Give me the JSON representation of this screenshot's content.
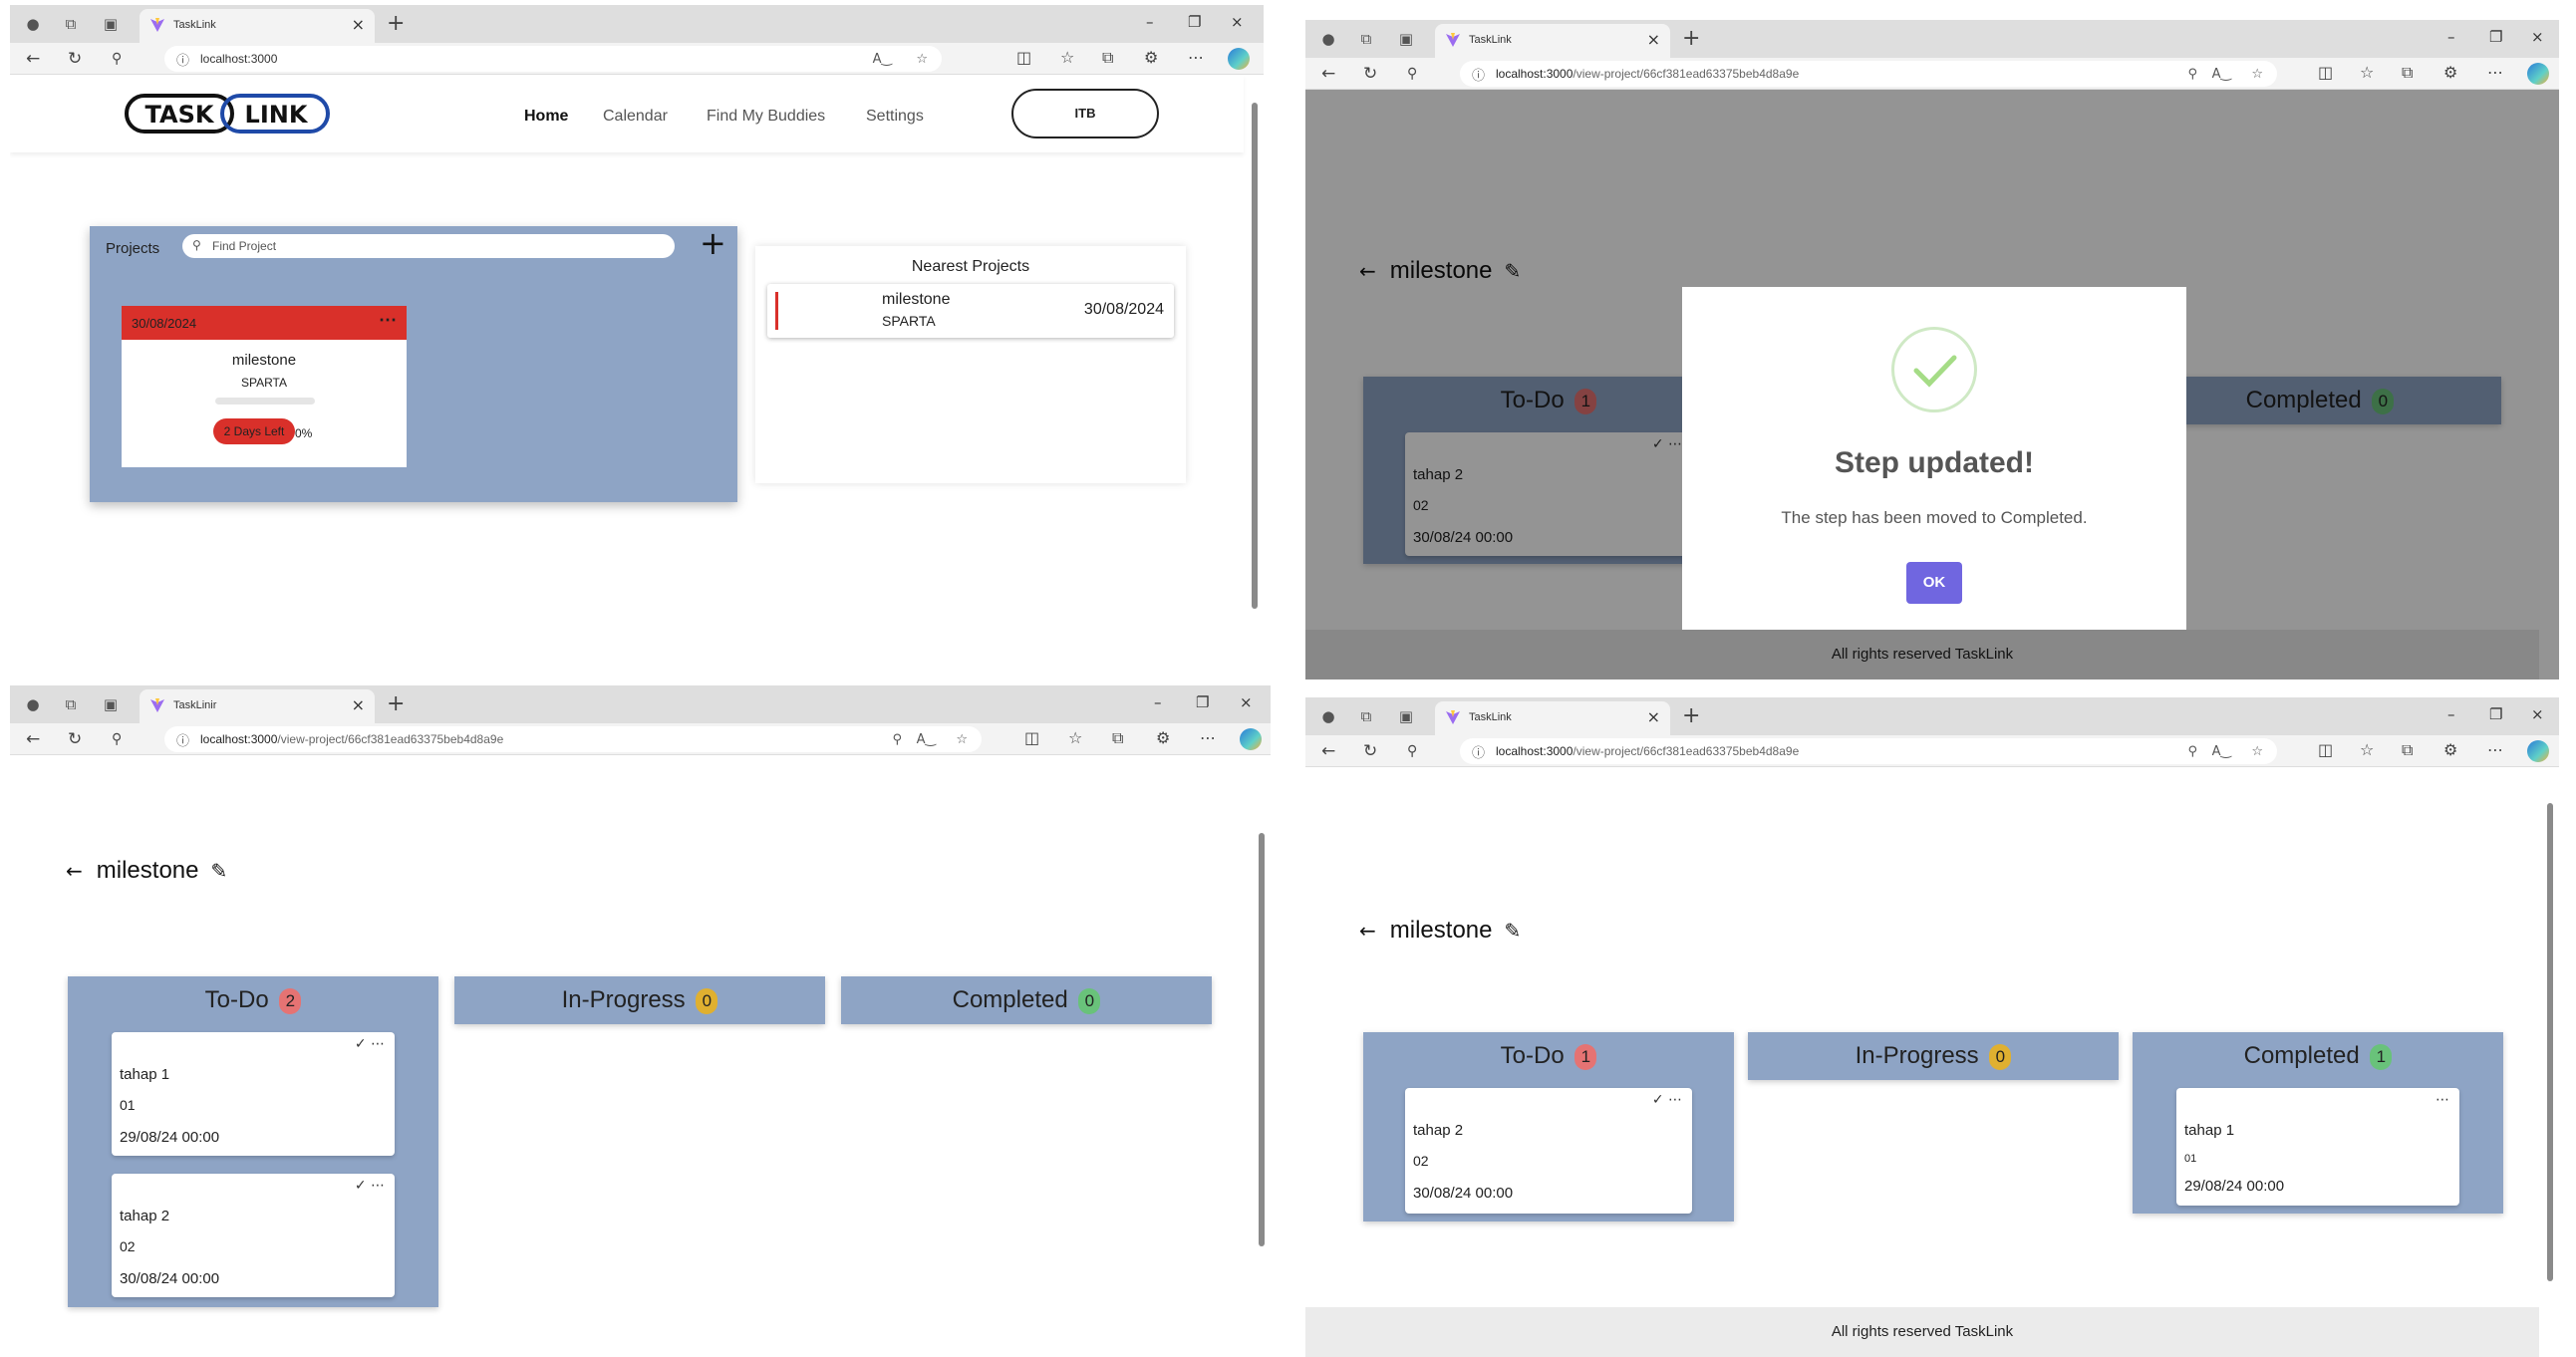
{
  "browser": {
    "tab_title": "TaskLink",
    "tab_title_c": "TaskLinir",
    "url_home": "localhost:3000",
    "url_host": "localhost:3000",
    "url_path": "/view-project/66cf381ead63375beb4d8a9e"
  },
  "home": {
    "nav": {
      "home": "Home",
      "calendar": "Calendar",
      "find_buddies": "Find My Buddies",
      "settings": "Settings"
    },
    "user_button": "ITB",
    "logo_left": "TASK",
    "logo_right": "LINK",
    "projects_label": "Projects",
    "search_placeholder": "Find Project",
    "project_card": {
      "date": "30/08/2024",
      "name": "milestone",
      "owner": "SPARTA",
      "days_left": "2 Days Left",
      "progress_pct": 0,
      "progress_text": "0%"
    },
    "nearest": {
      "title": "Nearest Projects",
      "name": "milestone",
      "owner": "SPARTA",
      "date": "30/08/2024"
    }
  },
  "project": {
    "title": "milestone",
    "columns": {
      "todo": "To-Do",
      "inprogress": "In-Progress",
      "completed": "Completed"
    },
    "view_c": {
      "counts": {
        "todo": "2",
        "inprogress": "0",
        "completed": "0"
      },
      "steps": [
        {
          "name": "tahap 1",
          "no": "01",
          "date": "29/08/24 00:00"
        },
        {
          "name": "tahap 2",
          "no": "02",
          "date": "30/08/24 00:00"
        }
      ]
    },
    "view_b": {
      "counts": {
        "todo": "1",
        "completed": "0"
      },
      "step": {
        "name": "tahap 2",
        "no": "02",
        "date": "30/08/24 00:00"
      }
    },
    "view_d": {
      "counts": {
        "todo": "1",
        "inprogress": "0",
        "completed": "1"
      },
      "todo_step": {
        "name": "tahap 2",
        "no": "02",
        "date": "30/08/24 00:00"
      },
      "done_step": {
        "name": "tahap 1",
        "no": "01",
        "date": "29/08/24 00:00"
      }
    },
    "footer": "All rights reserved TaskLink"
  },
  "modal": {
    "title": "Step updated!",
    "text": "The step has been moved to Completed.",
    "ok": "OK"
  },
  "colors": {
    "card_blue": "#8ea4c5",
    "accent_red": "#d9302a",
    "ok_purple": "#7066e0"
  }
}
